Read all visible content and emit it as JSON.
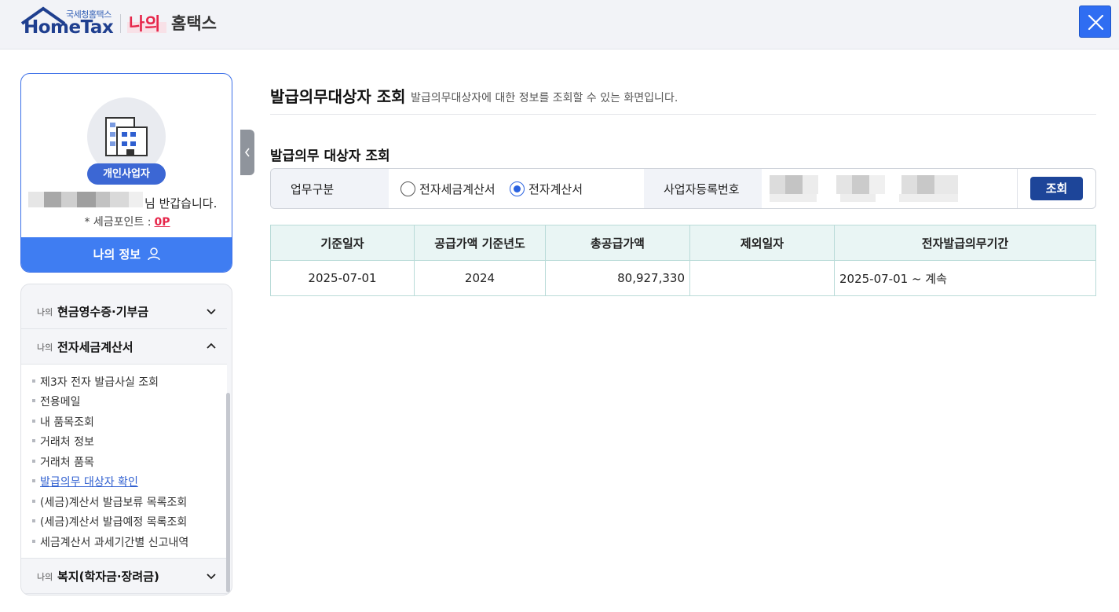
{
  "header": {
    "logo_small": "국세청홈택스",
    "logo_brand": "HomeTax",
    "my_label": "나의",
    "home_label": "홈택스",
    "close_icon": "close-icon"
  },
  "profile": {
    "badge": "개인사업자",
    "greeting": "님 반갑습니다.",
    "points_label": "* 세금포인트 :",
    "points_value": "0P",
    "myinfo_button": "나의 정보"
  },
  "menu": {
    "sections": [
      {
        "prefix": "나의",
        "title": "현금영수증·기부금"
      },
      {
        "prefix": "나의",
        "title": "전자세금계산서"
      },
      {
        "prefix": "나의",
        "title": "복지(학자금·장려금)"
      }
    ],
    "items": [
      "제3자 전자 발급사실 조회",
      "전용메일",
      "내 품목조회",
      "거래처 정보",
      "거래처 품목",
      "발급의무 대상자 확인",
      "(세금)계산서 발급보류 목록조회",
      "(세금)계산서 발급예정 목록조회",
      "세금계산서 과세기간별 신고내역"
    ]
  },
  "main": {
    "title": "발급의무대상자 조회",
    "description": "발급의무대상자에 대한 정보를 조회할 수 있는 화면입니다.",
    "section_title": "발급의무 대상자 조회",
    "search": {
      "label_type": "업무구분",
      "option1": "전자세금계산서",
      "option2": "전자계산서",
      "selected": "전자계산서",
      "label_bizno": "사업자등록번호",
      "button": "조회"
    },
    "table": {
      "headers": [
        "기준일자",
        "공급가액 기준년도",
        "총공급가액",
        "제외일자",
        "전자발급의무기간"
      ],
      "rows": [
        [
          "2025-07-01",
          "2024",
          "80,927,330",
          "",
          "2025-07-01 ~ 계속"
        ]
      ]
    }
  }
}
